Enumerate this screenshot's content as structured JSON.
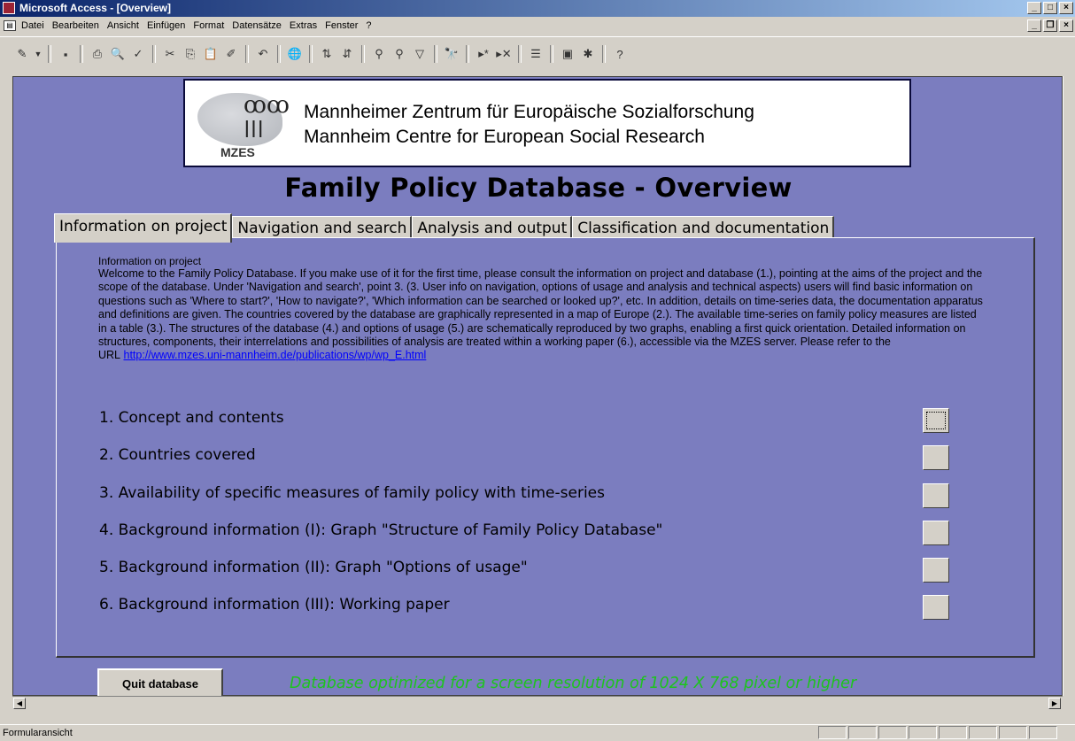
{
  "window": {
    "title": "Microsoft Access - [Overview]",
    "buttons": {
      "minimize": "_",
      "restore": "□",
      "close": "×"
    }
  },
  "menu": {
    "items": [
      "Datei",
      "Bearbeiten",
      "Ansicht",
      "Einfügen",
      "Format",
      "Datensätze",
      "Extras",
      "Fenster",
      "?"
    ],
    "doc_buttons": {
      "minimize": "_",
      "restore": "❐",
      "close": "×"
    }
  },
  "toolbar": {
    "icons": [
      "design-view",
      "save",
      "print",
      "print-preview",
      "spelling",
      "cut",
      "copy",
      "paste",
      "format-painter",
      "undo",
      "hyperlink",
      "sort-ascending",
      "sort-descending",
      "filter-by-selection",
      "filter-by-form",
      "apply-filter",
      "find",
      "new-record",
      "delete-record",
      "properties",
      "database-window",
      "new-object",
      "help"
    ],
    "glyphs": [
      "✎",
      "▼",
      "▪",
      "⎙",
      "🔍",
      "✓",
      "✂",
      "⎘",
      "📋",
      "✐",
      "↶",
      "🌐",
      "⇅",
      "⇵",
      "⚲",
      "⚲",
      "▽",
      "🔭",
      "▸*",
      "▸✕",
      "☰",
      "▣",
      "✱",
      "?"
    ]
  },
  "logo": {
    "line1": "Mannheimer Zentrum für Europäische Sozialforschung",
    "line2": "Mannheim Centre for European Social Research",
    "badge": "MZES"
  },
  "page": {
    "title": "Family Policy Database - Overview"
  },
  "tabs": [
    {
      "label": "Information on project",
      "active": true
    },
    {
      "label": "Navigation and search",
      "active": false
    },
    {
      "label": "Analysis and output",
      "active": false
    },
    {
      "label": "Classification and documentation",
      "active": false
    }
  ],
  "info": {
    "title": "Information on project",
    "text": "Welcome to the Family Policy Database. If you make use of it for the first time, please consult the information on project and database (1.), pointing at the aims of the project and the scope of the database. Under 'Navigation and search', point 3. (3. User info on navigation, options of usage and analysis and technical aspects) users will find basic information on questions such as 'Where to start?', 'How to navigate?', 'Which information can be searched or looked up?', etc. In addition, details on time-series data, the documentation apparatus and definitions are given. The countries covered by the database are graphically represented in a map of Europe (2.). The available time-series on family policy measures are listed in a table (3.). The structures of the database (4.) and options of usage (5.) are schematically reproduced by two graphs, enabling a first quick orientation. Detailed information on structures, components, their interrelations and possibilities of analysis are treated within a working paper (6.), accessible via the MZES server. Please refer to the URL",
    "url": "http://www.mzes.uni-mannheim.de/publications/wp/wp_E.html"
  },
  "items": [
    "1. Concept and contents",
    "2. Countries covered",
    "3. Availability of specific measures of family policy with time-series",
    "4. Background information (I): Graph \"Structure of Family Policy Database\"",
    "5. Background information (II): Graph \"Options of usage\"",
    "6. Background information (III): Working paper"
  ],
  "buttons": {
    "quit": "Quit database"
  },
  "note": "Database optimized for a screen resolution of 1024 X 768 pixel or higher",
  "status": {
    "text": "Formularansicht"
  },
  "colors": {
    "form_bg": "#7b7dbf",
    "note": "#1dc41d",
    "link": "#0000ff"
  }
}
